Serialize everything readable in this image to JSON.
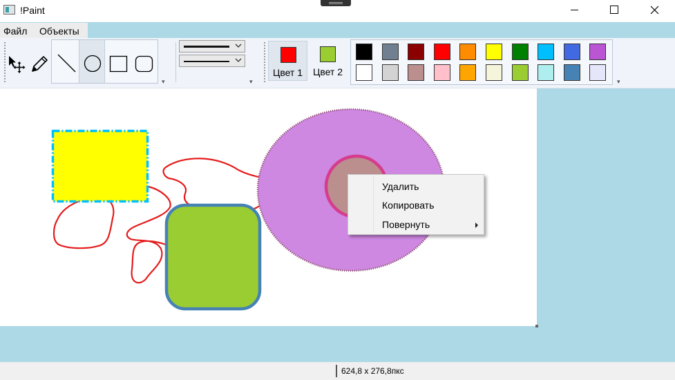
{
  "window": {
    "title": "!Paint"
  },
  "menu": {
    "items": [
      {
        "label": "Файл"
      },
      {
        "label": "Объекты"
      }
    ]
  },
  "toolbar": {
    "tools": [
      "select-move",
      "pencil"
    ],
    "shapes": [
      "line",
      "ellipse",
      "rectangle",
      "rounded-rectangle"
    ],
    "selected_shape": "ellipse",
    "color1": {
      "label": "Цвет 1",
      "value": "#FF0000"
    },
    "color2": {
      "label": "Цвет 2",
      "value": "#9ACD32"
    },
    "palette": [
      "#000000",
      "#708090",
      "#8B0000",
      "#FF0000",
      "#FF8C00",
      "#FFFF00",
      "#008000",
      "#00BFFF",
      "#4169E1",
      "#BA55D3",
      "#FFFFFF",
      "#D3D3D3",
      "#BC8F8F",
      "#FFC0CB",
      "#FFA500",
      "#F5F5DC",
      "#9ACD32",
      "#AFEEEE",
      "#4682B4",
      "#E6E6FA"
    ]
  },
  "canvas": {
    "shapes": [
      {
        "type": "rectangle",
        "fill": "#FFFF00",
        "stroke": "#00BFFF",
        "style": "dash-dot"
      },
      {
        "type": "rounded-rectangle",
        "fill": "#9ACD32",
        "stroke": "#4682B4"
      },
      {
        "type": "ellipse",
        "fill": "#CE88E2",
        "stroke": "#8B4A6B",
        "style": "dotted",
        "selected": true
      },
      {
        "type": "ellipse",
        "fill": "#BC8F8F",
        "stroke": "#D63C8C"
      },
      {
        "type": "freehand",
        "stroke": "#E41B1B"
      }
    ]
  },
  "context_menu": {
    "items": [
      {
        "label": "Удалить"
      },
      {
        "label": "Копировать"
      },
      {
        "label": "Повернуть",
        "submenu": true
      }
    ]
  },
  "status": {
    "size": "624,8 x 276,8пкс"
  },
  "colors": {
    "workspace_bg": "#ADD8E6",
    "toolbar_bg": "#F0F4FA"
  }
}
